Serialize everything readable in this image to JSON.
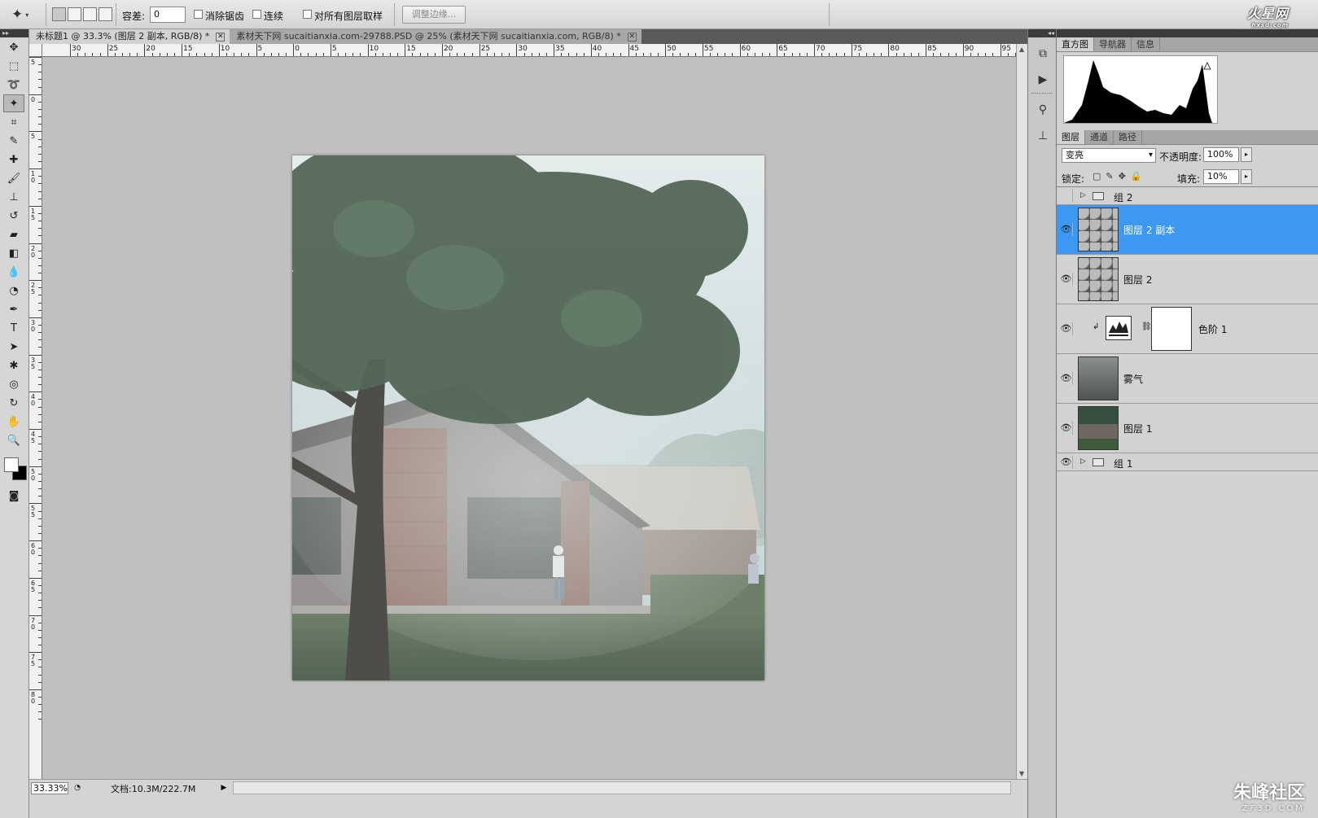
{
  "options_bar": {
    "tolerance_label": "容差:",
    "tolerance_value": "0",
    "antialias_label": "消除锯齿",
    "contiguous_label": "连续",
    "sample_all_label": "对所有图层取样",
    "refine_edge_label": "调整边缘..."
  },
  "logo": {
    "main": "火星网",
    "sub": "hxsd.com"
  },
  "document_tabs": [
    {
      "label": "未标题1 @ 33.3% (图层 2 副本, RGB/8) *",
      "active": true
    },
    {
      "label": "素材天下网 sucaitianxia.com-29788.PSD @ 25% (素材天下网 sucaitianxia.com, RGB/8) *",
      "active": false
    }
  ],
  "ruler_h_labels": [
    "30",
    "25",
    "20",
    "15",
    "10",
    "5",
    "0",
    "5",
    "10",
    "15",
    "20",
    "25",
    "30",
    "35",
    "40",
    "45",
    "50",
    "55",
    "60",
    "65",
    "70",
    "75",
    "80",
    "85",
    "90",
    "95"
  ],
  "ruler_v_labels": [
    "5",
    "0",
    "5",
    "10",
    "15",
    "20",
    "25",
    "30",
    "35",
    "40",
    "45",
    "50",
    "55",
    "60",
    "65",
    "70",
    "75",
    "80"
  ],
  "status": {
    "zoom": "33.33%",
    "doc": "文档:10.3M/222.7M"
  },
  "panel_top_tabs": [
    "直方图",
    "导航器",
    "信息"
  ],
  "panel_layer_tabs": [
    "图层",
    "通道",
    "路径"
  ],
  "layers_panel": {
    "blend_mode": "变亮",
    "opacity_label": "不透明度:",
    "opacity_value": "100%",
    "lock_label": "锁定:",
    "fill_label": "填充:",
    "fill_value": "10%"
  },
  "layers": [
    {
      "name": "组 2",
      "kind": "group",
      "visible": false
    },
    {
      "name": "图层 2 副本",
      "kind": "layer",
      "visible": true,
      "selected": true
    },
    {
      "name": "图层 2",
      "kind": "layer",
      "visible": true
    },
    {
      "name": "色阶 1",
      "kind": "adjustment",
      "visible": true
    },
    {
      "name": "雾气",
      "kind": "layer",
      "visible": true
    },
    {
      "name": "图层 1",
      "kind": "layer",
      "visible": true
    },
    {
      "name": "组 1",
      "kind": "group",
      "visible": true
    }
  ],
  "watermark": {
    "main": "朱峰社区",
    "sub": "ZF3D.COM"
  },
  "colors": {
    "selection": "#3c98f0",
    "canvas_bg": "#c0c0c0",
    "chrome": "#d2d2d2"
  }
}
